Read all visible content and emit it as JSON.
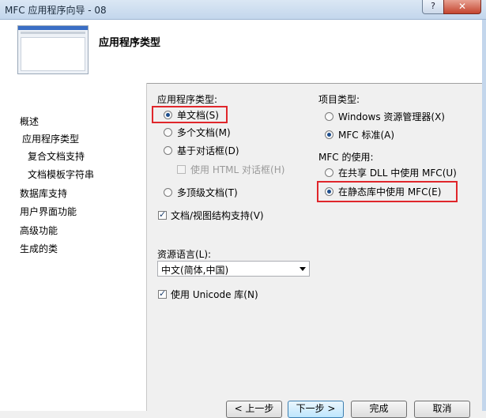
{
  "window": {
    "title": "MFC 应用程序向导 - 08",
    "help_glyph": "?",
    "close_glyph": "✕"
  },
  "header": {
    "title": "应用程序类型"
  },
  "nav": {
    "items": [
      "概述",
      "应用程序类型",
      "复合文档支持",
      "文档模板字符串",
      "数据库支持",
      "用户界面功能",
      "高级功能",
      "生成的类"
    ]
  },
  "app_type": {
    "group_label": "应用程序类型:",
    "options": [
      "单文档(S)",
      "多个文档(M)",
      "基于对话框(D)",
      "多顶级文档(T)"
    ],
    "selected": "单文档(S)",
    "html_dialog_label": "使用 HTML 对话框(H)",
    "doc_view_label": "文档/视图结构支持(V)"
  },
  "resource": {
    "label": "资源语言(L):",
    "value": "中文(简体,中国)",
    "unicode_label": "使用 Unicode 库(N)"
  },
  "project": {
    "group_label": "项目类型:",
    "options": [
      "Windows 资源管理器(X)",
      "MFC 标准(A)"
    ],
    "selected": "MFC 标准(A)"
  },
  "mfc_use": {
    "group_label": "MFC 的使用:",
    "options": [
      "在共享 DLL 中使用 MFC(U)",
      "在静态库中使用 MFC(E)"
    ],
    "selected": "在静态库中使用 MFC(E)"
  },
  "buttons": {
    "back": "< 上一步",
    "next": "下一步 >",
    "finish": "完成",
    "cancel": "取消"
  },
  "colors": {
    "highlight": "#e0262b",
    "nav_active": "#1c4d8c"
  }
}
